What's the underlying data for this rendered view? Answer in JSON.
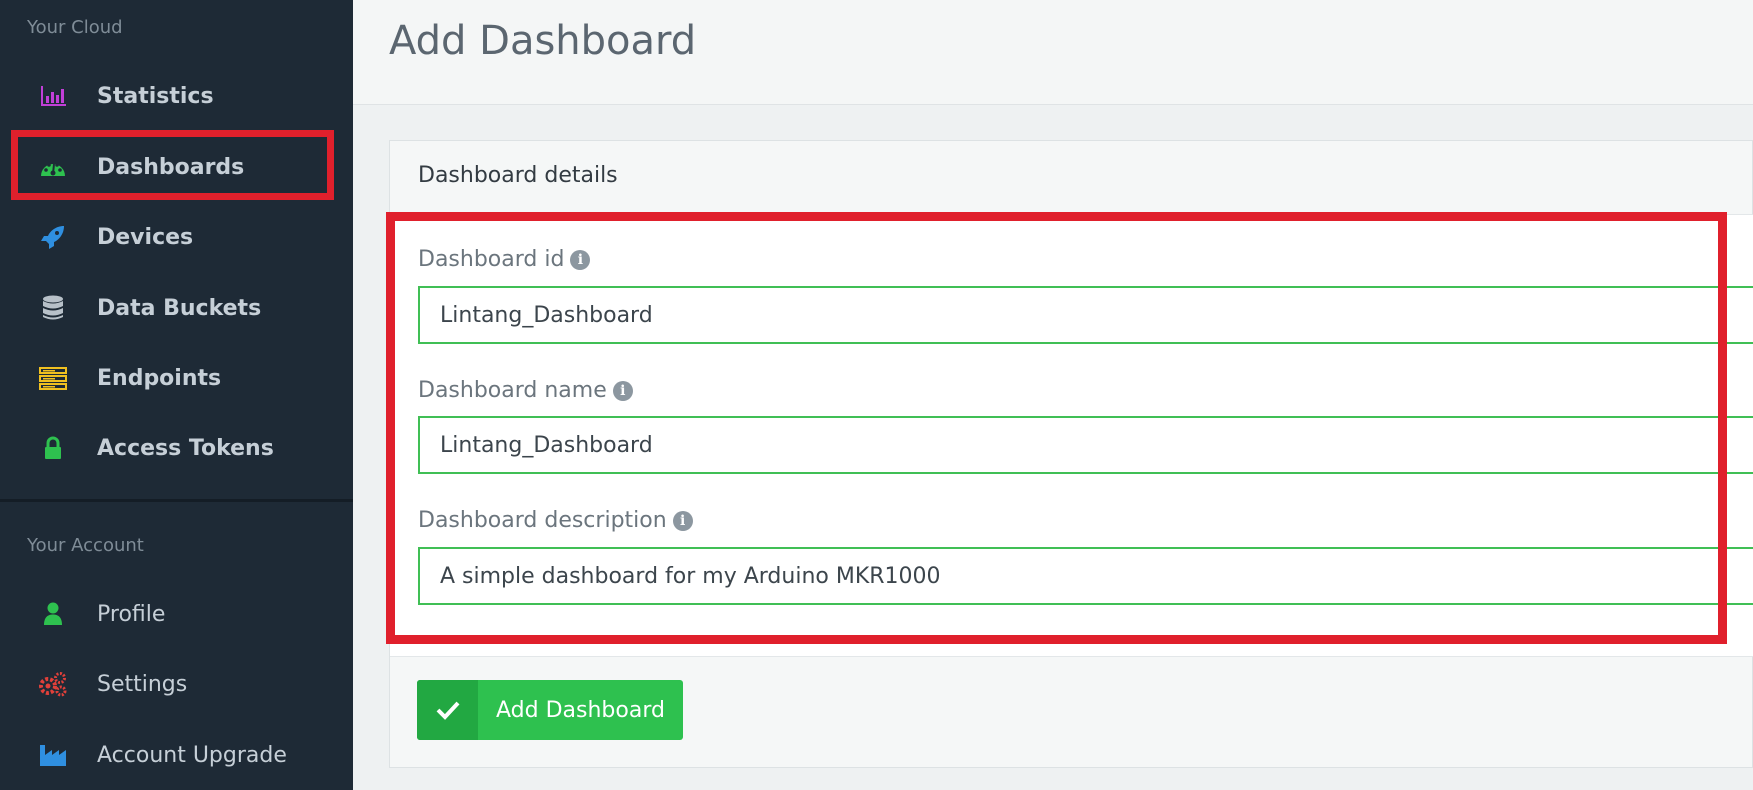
{
  "sidebar": {
    "cloud_section": "Your Cloud",
    "cloud_items": [
      {
        "label": "Statistics",
        "icon": "bar-chart-icon",
        "color": "#c23fd8"
      },
      {
        "label": "Dashboards",
        "icon": "speedometer-icon",
        "color": "#2ec14f"
      },
      {
        "label": "Devices",
        "icon": "rocket-icon",
        "color": "#2f8fe0"
      },
      {
        "label": "Data Buckets",
        "icon": "database-icon",
        "color": "#b7c0c8"
      },
      {
        "label": "Endpoints",
        "icon": "server-icon",
        "color": "#f0c020"
      },
      {
        "label": "Access Tokens",
        "icon": "lock-icon",
        "color": "#2ec14f"
      }
    ],
    "account_section": "Your Account",
    "account_items": [
      {
        "label": "Profile",
        "icon": "user-icon",
        "color": "#2ec14f"
      },
      {
        "label": "Settings",
        "icon": "gears-icon",
        "color": "#e0403a"
      },
      {
        "label": "Account Upgrade",
        "icon": "industry-icon",
        "color": "#2f8fe0"
      }
    ]
  },
  "page": {
    "title": "Add Dashboard"
  },
  "form": {
    "panel_title": "Dashboard details",
    "fields": [
      {
        "label": "Dashboard id",
        "value": "Lintang_Dashboard"
      },
      {
        "label": "Dashboard name",
        "value": "Lintang_Dashboard"
      },
      {
        "label": "Dashboard description",
        "value": "A simple dashboard for my Arduino MKR1000"
      }
    ],
    "submit_label": "Add Dashboard"
  },
  "colors": {
    "sidebar_bg": "#1e2a36",
    "accent_green": "#2ec14f",
    "highlight_red": "#e0202c"
  }
}
